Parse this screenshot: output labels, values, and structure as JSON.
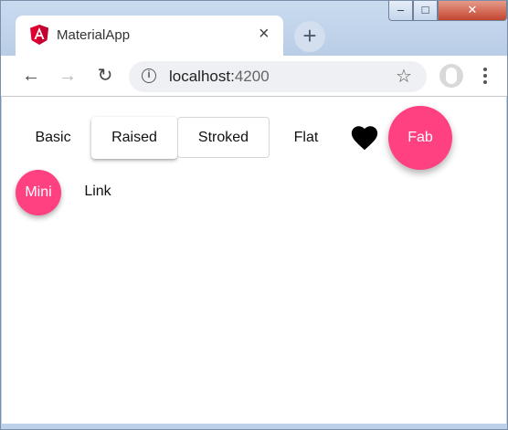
{
  "browser": {
    "tab_title": "MaterialApp",
    "tab_close": "×",
    "new_tab": "+",
    "url_host": "localhost:",
    "url_port": "4200",
    "window_controls": {
      "minimize": "‒",
      "maximize": "□",
      "close": "✕"
    },
    "icons": {
      "back": "arrow-left-icon",
      "forward": "arrow-right-icon",
      "reload": "reload-icon",
      "info": "info-icon",
      "bookmark": "star-icon",
      "profile": "profile-icon",
      "menu": "kebab-menu-icon"
    },
    "nav_glyphs": {
      "back": "←",
      "forward": "→",
      "reload": "↻",
      "info": "i",
      "star": "☆"
    }
  },
  "buttons": {
    "basic": "Basic",
    "raised": "Raised",
    "stroked": "Stroked",
    "flat": "Flat",
    "fab": "Fab",
    "mini": "Mini",
    "link": "Link"
  },
  "colors": {
    "accent": "#ff4081",
    "heart": "#000000",
    "angular_red": "#dd0031"
  }
}
